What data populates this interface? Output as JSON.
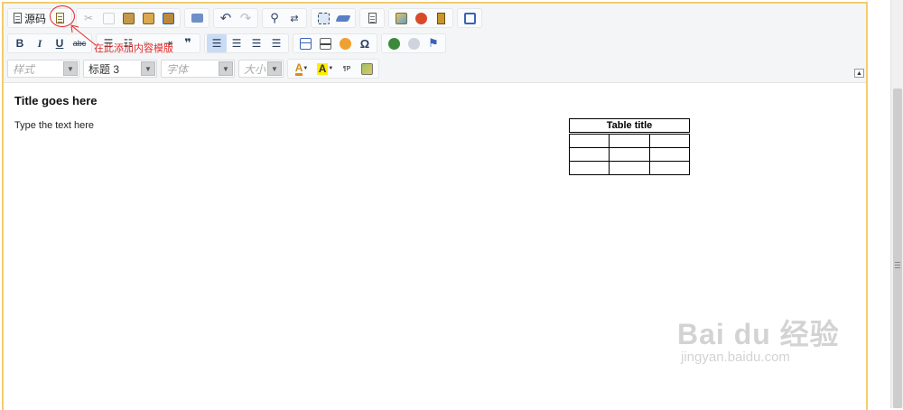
{
  "toolbar": {
    "source_label": "源码",
    "styles_combo": "样式",
    "format_combo": "标题 3",
    "font_combo": "字体",
    "size_combo": "大小",
    "bold": "B",
    "italic": "I",
    "underline": "U",
    "strike": "abc",
    "quote": "❞",
    "omega": "Ω",
    "collapse": "▲",
    "icons": [
      "template-icon",
      "cut-icon",
      "copy-icon",
      "paste-icon",
      "paste-text-icon",
      "paste-word-icon",
      "print-icon",
      "undo-icon",
      "redo-icon",
      "find-icon",
      "replace-icon",
      "select-all-icon",
      "remove-format-icon",
      "preview-icon",
      "image-icon",
      "flash-icon",
      "document-icon",
      "maximize-icon"
    ]
  },
  "annotation": {
    "note": "在此添加内容模版",
    "color": "#e32a2a"
  },
  "document": {
    "title": "Title goes here",
    "body": "Type the text here",
    "table": {
      "caption": "Table title",
      "rows": 3,
      "cols": 3
    }
  },
  "watermark": {
    "brand": "Bai du 经验",
    "url": "jingyan.baidu.com"
  },
  "colors": {
    "editor_border": "#f3cd6c",
    "toolbar_bg": "#f4f5f6",
    "active_button": "#c9dcf3"
  }
}
